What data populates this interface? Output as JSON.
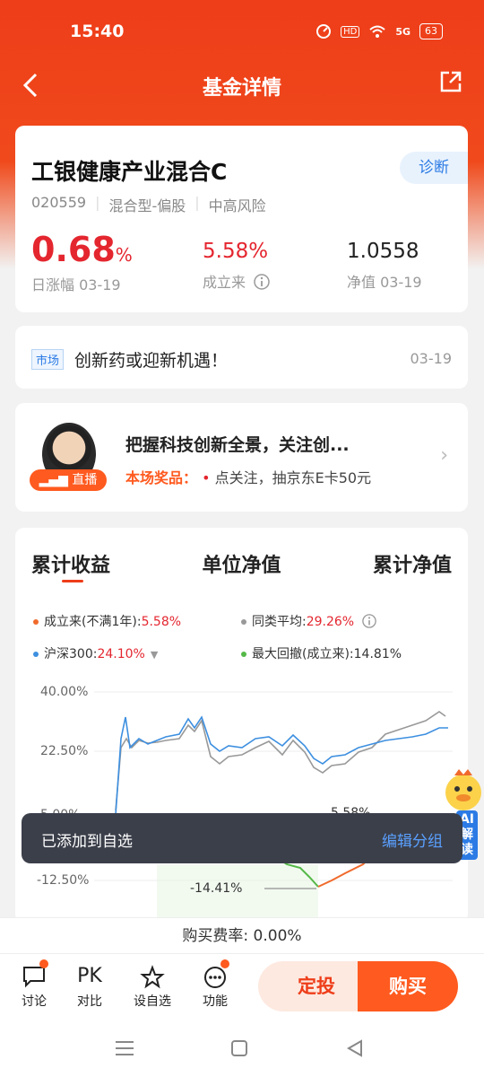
{
  "status": {
    "time": "15:40",
    "network": "5G",
    "battery": "63"
  },
  "nav": {
    "title": "基金详情"
  },
  "fund": {
    "name": "工银健康产业混合C",
    "diagnose_label": "诊断",
    "code": "020559",
    "type": "混合型-偏股",
    "risk": "中高风险",
    "daily_change": "0.68",
    "daily_change_unit": "%",
    "daily_label": "日涨幅 03-19",
    "since_inception": "5.58%",
    "since_label": "成立来",
    "nav_value": "1.0558",
    "nav_label": "净值 03-19"
  },
  "news": {
    "tag": "市场",
    "text": "创新药或迎新机遇！",
    "date": "03-19"
  },
  "live": {
    "badge": "直播",
    "title": "把握科技创新全景，关注创...",
    "prize_key": "本场奖品：",
    "prize_text": "点关注，抽京东E卡50元"
  },
  "chart": {
    "tabs": [
      "累计收益",
      "单位净值",
      "累计净值"
    ],
    "legend": {
      "fund_label": "成立来(不满1年):",
      "fund_value": "5.58%",
      "peer_label": "同类平均:",
      "peer_value": "29.26%",
      "index_label": "沪深300:",
      "index_value": "24.10%",
      "drawdown_label": "最大回撤(成立来):",
      "drawdown_value": "14.81%"
    },
    "y_labels": [
      "40.00%",
      "22.50%",
      "5.00%",
      "-12.50%"
    ],
    "annotations": {
      "low": "-14.41%",
      "end": "5.58%"
    },
    "colors": {
      "fund": "#f06a2c",
      "peer": "#999999",
      "index": "#3d8fe0",
      "drawdown": "#55b848"
    }
  },
  "toast": {
    "text": "已添加到自选",
    "action": "编辑分组"
  },
  "mascot": {
    "label": "AI解读"
  },
  "fee": {
    "text": "购买费率: 0.00%"
  },
  "bottom": {
    "items": [
      "讨论",
      "对比",
      "设自选",
      "功能"
    ],
    "pk_text": "PK",
    "auto_invest": "定投",
    "buy": "购买"
  }
}
